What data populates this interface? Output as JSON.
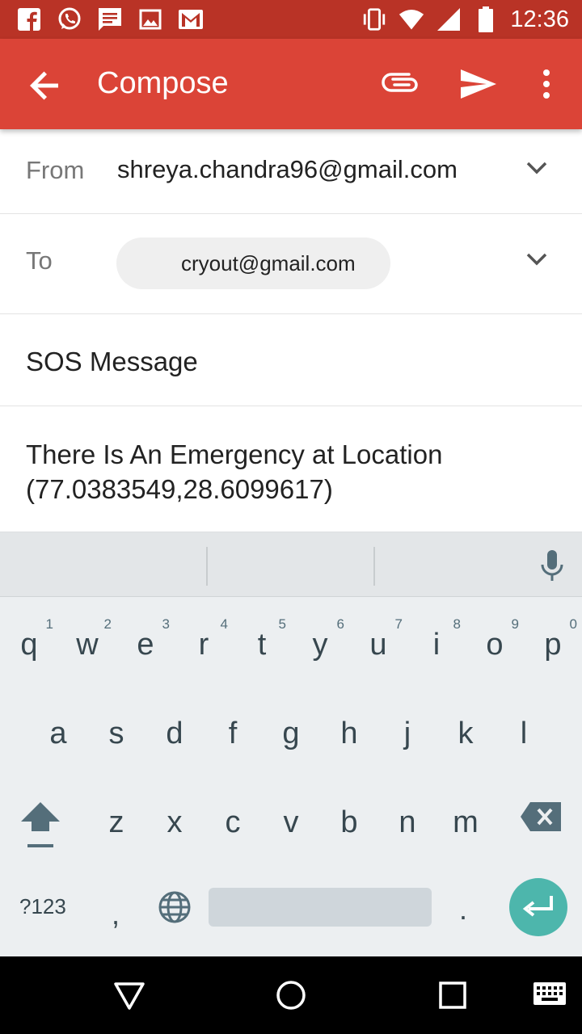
{
  "status_bar": {
    "time": "12:36",
    "left_icons": [
      "facebook-icon",
      "whatsapp-icon",
      "message-icon",
      "image-icon",
      "gmail-icon"
    ],
    "right_icons": [
      "vibrate-icon",
      "wifi-icon",
      "signal-icon",
      "battery-icon"
    ]
  },
  "app_bar": {
    "title": "Compose",
    "color": "#db4437",
    "status_color": "#b93326"
  },
  "from": {
    "label": "From",
    "value": "shreya.chandra96@gmail.com"
  },
  "to": {
    "label": "To",
    "chip": "cryout@gmail.com"
  },
  "subject": "SOS Message",
  "body": "There Is An Emergency at Location (77.0383549,28.6099617)",
  "keyboard": {
    "row1": [
      {
        "ch": "q",
        "num": "1"
      },
      {
        "ch": "w",
        "num": "2"
      },
      {
        "ch": "e",
        "num": "3"
      },
      {
        "ch": "r",
        "num": "4"
      },
      {
        "ch": "t",
        "num": "5"
      },
      {
        "ch": "y",
        "num": "6"
      },
      {
        "ch": "u",
        "num": "7"
      },
      {
        "ch": "i",
        "num": "8"
      },
      {
        "ch": "o",
        "num": "9"
      },
      {
        "ch": "p",
        "num": "0"
      }
    ],
    "row2": [
      "a",
      "s",
      "d",
      "f",
      "g",
      "h",
      "j",
      "k",
      "l"
    ],
    "row3": [
      "z",
      "x",
      "c",
      "v",
      "b",
      "n",
      "m"
    ],
    "symbols_label": "?123",
    "comma": ",",
    "period": ".",
    "enter_color": "#4db6ac"
  }
}
